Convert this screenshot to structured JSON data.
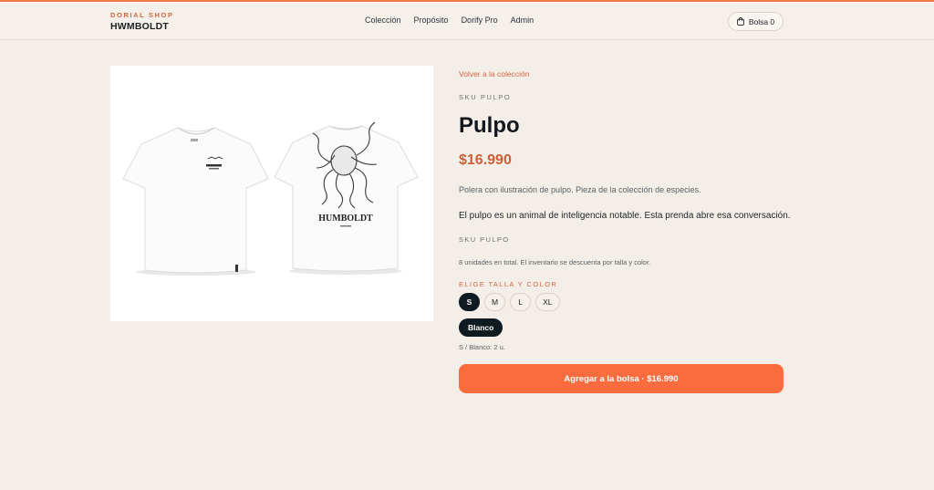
{
  "colors": {
    "accent": "#fa6b3d",
    "brand_orange": "#d4653e",
    "dark": "#0f1a21",
    "background": "#f3efe8"
  },
  "header": {
    "brand_sub": "DORIAL SHOP",
    "brand_name": "HWMBOLDT",
    "nav": [
      "Colección",
      "Propósito",
      "Dorify Pro",
      "Admin"
    ],
    "bag_label": "Bolsa 0",
    "bag_icon": "shopping-bag-icon"
  },
  "product": {
    "back_link": "Volver a la colección",
    "sku_label": "SKU PULPO",
    "title": "Pulpo",
    "price": "$16.990",
    "description_short": "Polera con ilustración de pulpo. Pieza de la colección de especies.",
    "description_long": "El pulpo es un animal de inteligencia notable. Esta prenda abre esa conversación.",
    "sku_secondary": "SKU PULPO",
    "inventory_note": "8 unidades en total. El inventario se descuenta por talla y color.",
    "choose_label": "ELIGE TALLA Y COLOR",
    "sizes": [
      "S",
      "M",
      "L",
      "XL"
    ],
    "selected_size": "S",
    "colors_options": [
      "Blanco"
    ],
    "selected_color": "Blanco",
    "stock_note": "S / Blanco: 2 u.",
    "add_button": "Agregar a la bolsa · $16.990",
    "image_print_text": "HUMBOLDT"
  }
}
